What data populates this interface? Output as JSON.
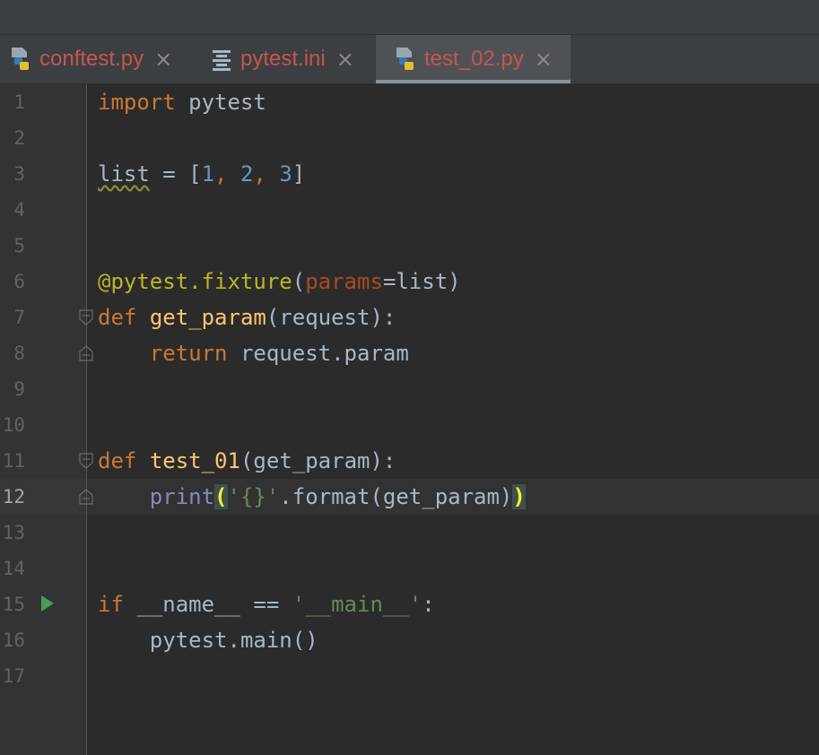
{
  "tabs": [
    {
      "label": "conftest.py",
      "icon": "python-file-icon",
      "active": false
    },
    {
      "label": "pytest.ini",
      "icon": "ini-file-icon",
      "active": false
    },
    {
      "label": "test_02.py",
      "icon": "python-file-icon",
      "active": true
    }
  ],
  "close_glyph": "×",
  "current_line": 12,
  "colors": {
    "keyword": "#cc7832",
    "number": "#6897bb",
    "decorator": "#bbb529",
    "function": "#ffc66d",
    "parameter": "#aa4926",
    "string": "#6a8759",
    "builtin": "#8888c6",
    "default": "#a9b7c6",
    "tab_label": "#c75450"
  },
  "line_numbers": [
    "1",
    "2",
    "3",
    "4",
    "5",
    "6",
    "7",
    "8",
    "9",
    "10",
    "11",
    "12",
    "13",
    "14",
    "15",
    "16",
    "17"
  ],
  "code": {
    "l1": {
      "kw": "import",
      "rest": " pytest"
    },
    "l3": {
      "var": "list",
      "eq": " = [",
      "n1": "1",
      "c1": ", ",
      "n2": "2",
      "c2": ", ",
      "n3": "3",
      "end": "]"
    },
    "l6": {
      "dec": "@pytest.fixture",
      "open": "(",
      "param": "params",
      "rest": "=list)"
    },
    "l7": {
      "kw": "def",
      "fn": "get_param",
      "rest": "(request):"
    },
    "l8": {
      "kw": "return",
      "rest": " request.param"
    },
    "l11": {
      "kw": "def",
      "fn": "test_01",
      "rest": "(get_param):"
    },
    "l12": {
      "builtin": "print",
      "lpar": "(",
      "str": "'{}'",
      "rest": ".format(get_param)",
      "rpar": ")"
    },
    "l15": {
      "kw": "if",
      "mid": " __name__ == ",
      "str": "'__main__'",
      "end": ":"
    },
    "l16": {
      "rest": "pytest.main()"
    }
  }
}
